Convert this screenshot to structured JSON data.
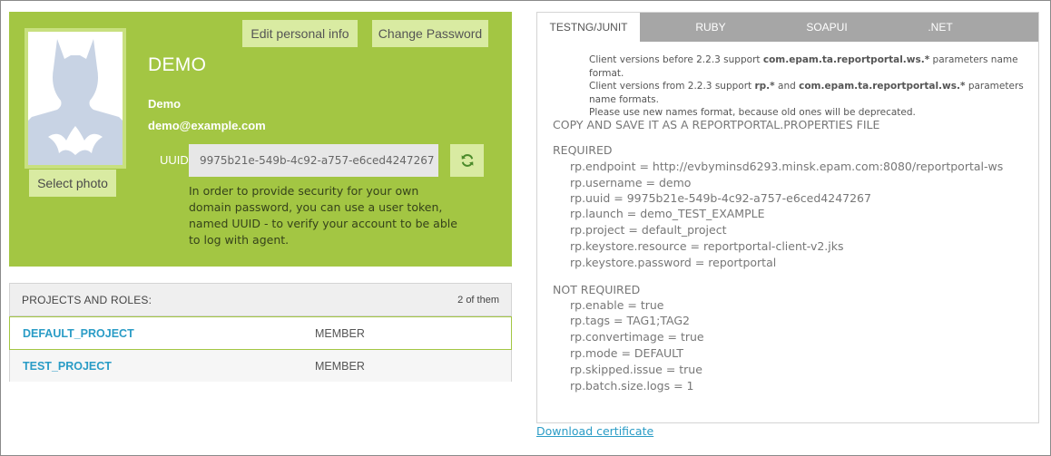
{
  "profile": {
    "edit_button": "Edit personal info",
    "change_password_button": "Change Password",
    "title": "DEMO",
    "name": "Demo",
    "email": "demo@example.com",
    "select_photo_button": "Select photo",
    "uuid_label": "UUID",
    "uuid_value": "9975b21e-549b-4c92-a757-e6ced4247267",
    "uuid_help": "In order to provide security for your own domain password, you can use a user token, named UUID - to verify your account to be able to log with agent.",
    "refresh_icon": "refresh-icon",
    "avatar_icon": "batman-silhouette-icon"
  },
  "projects": {
    "header": "Projects and roles:",
    "count": "2 of them",
    "rows": [
      {
        "name": "DEFAULT_PROJECT",
        "role": "MEMBER"
      },
      {
        "name": "TEST_PROJECT",
        "role": "MEMBER"
      }
    ]
  },
  "config": {
    "tabs": [
      "TestNG/JUnit",
      "Ruby",
      "SoapUI",
      ".NET"
    ],
    "notes": {
      "line1_prefix": "Client versions before 2.2.3 support ",
      "line1_bold": "com.epam.ta.reportportal.ws.*",
      "line1_suffix": " parameters name format.",
      "line2_prefix": "Client versions from 2.2.3 support ",
      "line2_bold1": "rp.*",
      "line2_mid": " and ",
      "line2_bold2": "com.epam.ta.reportportal.ws.*",
      "line2_suffix": " parameters name formats.",
      "line3": "Please use new names format, because old ones will be deprecated."
    },
    "heading": "COPY AND SAVE IT AS A REPORTPORTAL.PROPERTIES FILE",
    "required_label": "REQUIRED",
    "required": [
      "rp.endpoint = http://evbyminsd6293.minsk.epam.com:8080/reportportal-ws",
      "rp.username = demo",
      "rp.uuid = 9975b21e-549b-4c92-a757-e6ced4247267",
      "rp.launch = demo_TEST_EXAMPLE",
      "rp.project = default_project",
      "rp.keystore.resource = reportportal-client-v2.jks",
      "rp.keystore.password = reportportal"
    ],
    "not_required_label": "NOT REQUIRED",
    "not_required": [
      "rp.enable = true",
      "rp.tags = TAG1;TAG2",
      "rp.convertimage = true",
      "rp.mode = DEFAULT",
      "rp.skipped.issue = true",
      "rp.batch.size.logs = 1"
    ]
  },
  "download_link": "Download certificate",
  "colors": {
    "accent_green": "#a3c643",
    "link_blue": "#2a9cc6",
    "tab_gray": "#a6a6a6"
  }
}
